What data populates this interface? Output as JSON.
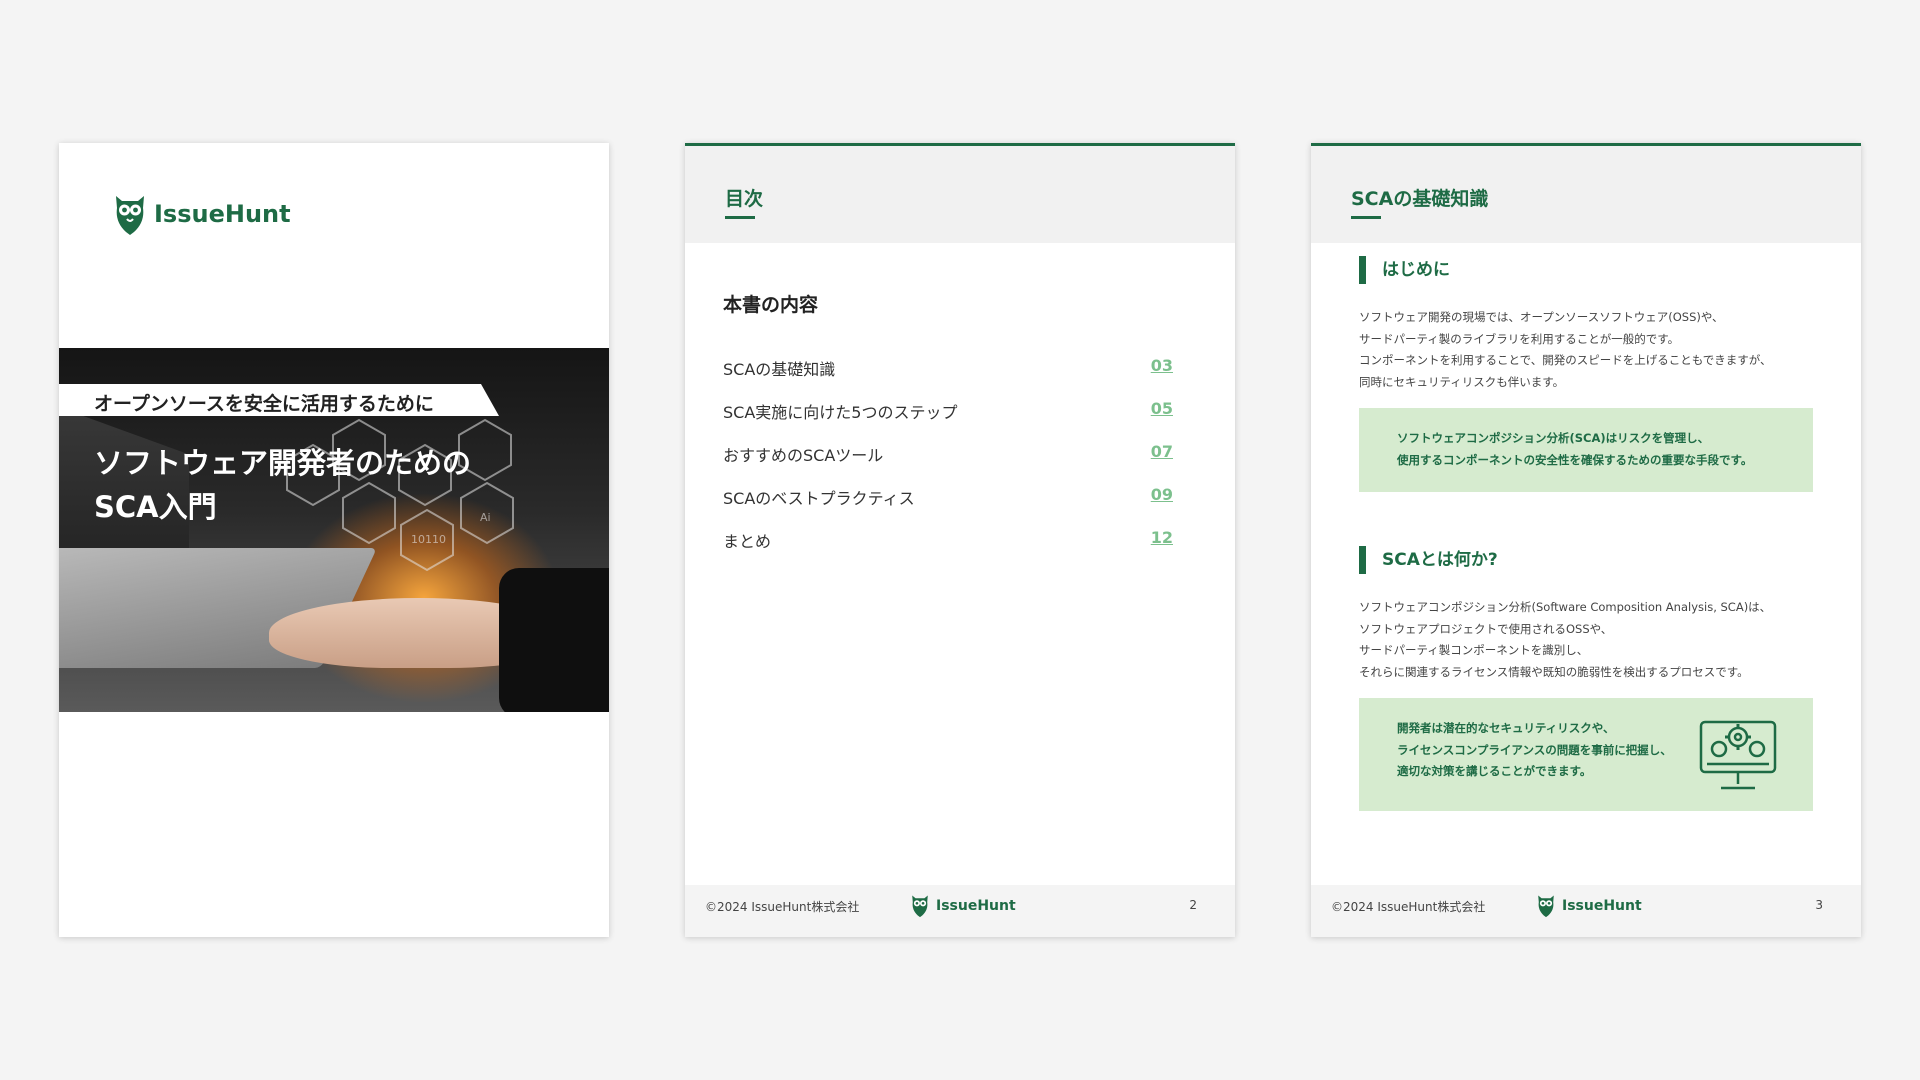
{
  "brand": {
    "name": "IssueHunt",
    "color": "#1e6b45",
    "light_green": "#d6ebcf",
    "link_green": "#7cc08d"
  },
  "cover": {
    "band_text": "オープンソースを安全に活用するために",
    "title_line1": "ソフトウェア開発者のための",
    "title_line2": "SCA入門"
  },
  "toc_page": {
    "header": "目次",
    "heading": "本書の内容",
    "items": [
      {
        "label": "SCAの基礎知識",
        "page": "03"
      },
      {
        "label": "SCA実施に向けた5つのステップ",
        "page": "05"
      },
      {
        "label": "おすすめのSCAツール",
        "page": "07"
      },
      {
        "label": "SCAのベストプラクティス",
        "page": "09"
      },
      {
        "label": "まとめ",
        "page": "12"
      }
    ],
    "footer_copy": "©2024 IssueHunt株式会社",
    "page_number": "2"
  },
  "basics_page": {
    "header": "SCAの基礎知識",
    "section1": {
      "heading": "はじめに",
      "lines": [
        "ソフトウェア開発の現場では、オープンソースソフトウェア(OSS)や、",
        "サードパーティ製のライブラリを利用することが一般的です。",
        "コンポーネントを利用することで、開発のスピードを上げることもできますが、",
        "同時にセキュリティリスクも伴います。"
      ],
      "callout": [
        "ソフトウェアコンポジション分析(SCA)はリスクを管理し、",
        "使用するコンポーネントの安全性を確保するための重要な手段です。"
      ]
    },
    "section2": {
      "heading": "SCAとは何か?",
      "lines": [
        "ソフトウェアコンポジション分析(Software Composition Analysis, SCA)は、",
        "ソフトウェアプロジェクトで使用されるOSSや、",
        "サードパーティ製コンポーネントを識別し、",
        "それらに関連するライセンス情報や既知の脆弱性を検出するプロセスです。"
      ],
      "callout": [
        "開発者は潜在的なセキュリティリスクや、",
        "ライセンスコンプライアンスの問題を事前に把握し、",
        "適切な対策を講じることができます。"
      ],
      "icon": "monitor-gears-icon"
    },
    "footer_copy": "©2024 IssueHunt株式会社",
    "page_number": "3"
  }
}
